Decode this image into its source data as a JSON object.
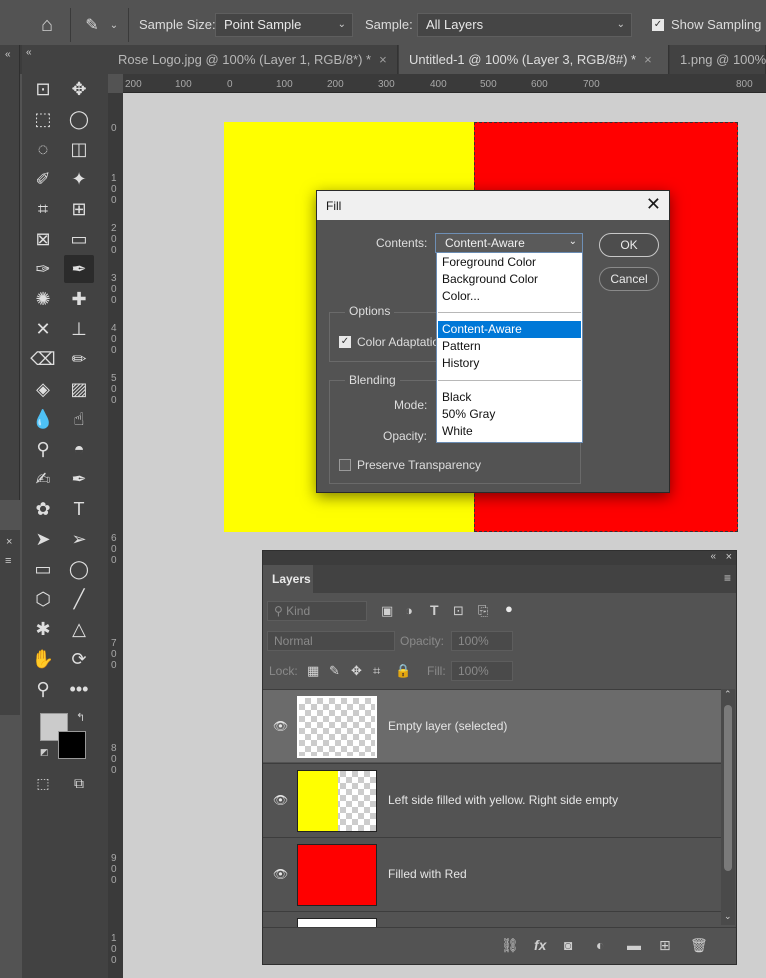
{
  "options_bar": {
    "sample_size_label": "Sample Size:",
    "sample_size_value": "Point Sample",
    "sample_label": "Sample:",
    "sample_value": "All Layers",
    "show_sampling_label": "Show Sampling R"
  },
  "tabs": [
    {
      "label": "Rose Logo.jpg @ 100% (Layer 1, RGB/8*) *"
    },
    {
      "label": "Untitled-1 @ 100% (Layer 3, RGB/8#) *"
    },
    {
      "label": "1.png @ 100%"
    }
  ],
  "rulers": {
    "h_ticks": [
      "200",
      "100",
      "0",
      "100",
      "200",
      "300",
      "400",
      "500",
      "600",
      "700",
      "800"
    ],
    "v_ticks": [
      "0",
      "1 0 0",
      "2 0 0",
      "3 0 0",
      "4 0 0",
      "5 0 0",
      "6 0 0",
      "7 0 0",
      "8 0 0",
      "9 0 0",
      "1 0 0"
    ]
  },
  "fill_dialog": {
    "title": "Fill",
    "contents_label": "Contents:",
    "contents_value": "Content-Aware",
    "ok_label": "OK",
    "cancel_label": "Cancel",
    "options_label": "Options",
    "color_adaptation_label": "Color Adaptatio",
    "blending_label": "Blending",
    "mode_label": "Mode:",
    "opacity_label": "Opacity:",
    "preserve_label": "Preserve Transparency",
    "dropdown_options": [
      "Foreground Color",
      "Background Color",
      "Color...",
      "Content-Aware",
      "Pattern",
      "History",
      "Black",
      "50% Gray",
      "White"
    ]
  },
  "layers_panel": {
    "tab_label": "Layers",
    "kind_placeholder": "Kind",
    "blend_mode": "Normal",
    "opacity_label": "Opacity:",
    "opacity_value": "100%",
    "lock_label": "Lock:",
    "fill_label": "Fill:",
    "fill_value": "100%",
    "layers": [
      {
        "name": "Empty layer (selected)"
      },
      {
        "name": "Left side filled with yellow. Right side empty"
      },
      {
        "name": "Filled with Red"
      }
    ]
  },
  "colors": {
    "yellow": "#ffff00",
    "red": "#ff0000",
    "highlight": "#0078d7"
  }
}
